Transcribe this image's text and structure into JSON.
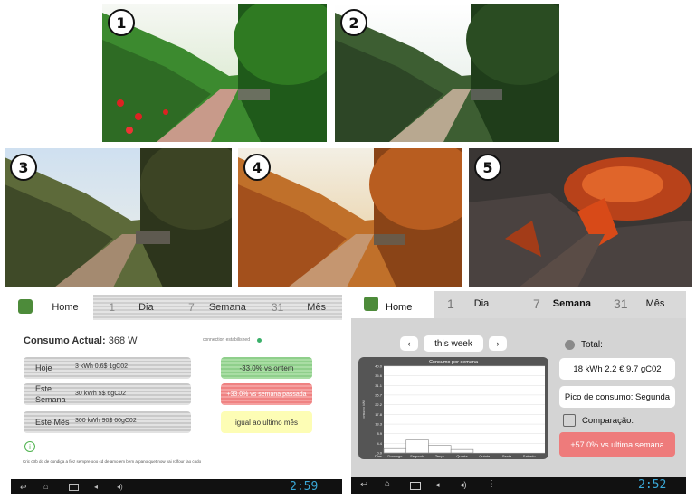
{
  "panels": [
    {
      "number": "1"
    },
    {
      "number": "2"
    },
    {
      "number": "3"
    },
    {
      "number": "4"
    },
    {
      "number": "5"
    }
  ],
  "left_app": {
    "tabs": {
      "home": "Home",
      "dia_num": "1",
      "dia": "Dia",
      "semana_num": "7",
      "semana": "Semana",
      "mes_num": "31",
      "mes": "Mês"
    },
    "consumo_label": "Consumo Actual:",
    "consumo_value": "368 W",
    "connection": "connection estabilished",
    "rows": [
      {
        "label": "Hoje",
        "value": "3 kWh 0.6$ 1gC02"
      },
      {
        "label": "Este Semana",
        "value": "30 kWh 5$ 6gC02"
      },
      {
        "label": "Este Mês",
        "value": "300 kWh 90$ 60gC02"
      }
    ],
    "comparisons": [
      {
        "text": "-33.0% vs ontem",
        "color": "#9ed39a"
      },
      {
        "text": "+33.0% vs semana passada",
        "color": "#f08f8f"
      },
      {
        "text": "igual ao ultimo mês",
        "color": "#fdfdb5"
      }
    ],
    "info_icon": "i",
    "tip": "Cric ctrb do de condiga a fiez sempre ooo cd de amo em bem a pano quet now vai rolfour fao codo",
    "clock": "2:59"
  },
  "right_app": {
    "tabs": {
      "home": "Home",
      "dia_num": "1",
      "dia": "Dia",
      "semana_num": "7",
      "semana": "Semana",
      "mes_num": "31",
      "mes": "Mês"
    },
    "prev": "‹",
    "week_label": "this week",
    "next": "›",
    "total_label": "Total:",
    "total_value": "18 kWh  2.2 €  9.7 gC02",
    "peak": "Pico de consumo: Segunda",
    "comparison_label": "Comparação:",
    "comparison_value": "+57.0% vs ultima semana",
    "clock": "2:52"
  },
  "chart_data": {
    "type": "bar",
    "title": "Consumo por semana",
    "xlabel": "",
    "ylabel": "consumo kWh",
    "categories": [
      "Domingo",
      "Segunda",
      "Terça",
      "Quarta",
      "Quinta",
      "Sexta",
      "Sabado"
    ],
    "values": [
      2.0,
      6.0,
      3.5,
      1.6,
      0,
      0,
      0
    ],
    "x_start_label": "Dias",
    "y_ticks": [
      "40.0",
      "35.6",
      "31.1",
      "26.7",
      "22.2",
      "17.8",
      "13.3",
      "8.9",
      "4.4",
      "0.0"
    ],
    "ylim": [
      0,
      40
    ]
  }
}
